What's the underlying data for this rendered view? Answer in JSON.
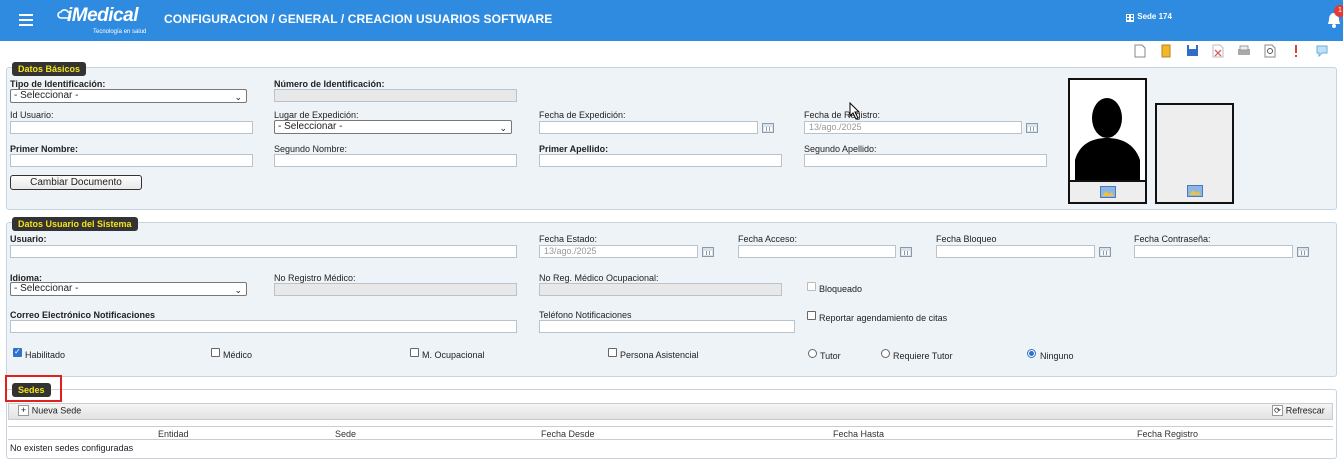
{
  "header": {
    "logo_name": "iMedical",
    "logo_tagline": "Tecnología en salud",
    "breadcrumb": "CONFIGURACION / GENERAL / CREACION USUARIOS SOFTWARE",
    "sede": "Sede 174",
    "notification_count": "1",
    "accent_color": "#2e8be0"
  },
  "toolbar": {
    "icons": [
      "new-document-icon",
      "attach-icon",
      "save-icon",
      "delete-icon",
      "print-icon",
      "search-document-icon",
      "alert-icon",
      "help-icon"
    ]
  },
  "datos_basicos": {
    "legend": "Datos Básicos",
    "tipo_id_label": "Tipo de Identificación:",
    "tipo_id_value": "- Seleccionar -",
    "numero_id_label": "Número de Identificación:",
    "id_usuario_label": "Id Usuario:",
    "lugar_exp_label": "Lugar de Expedición:",
    "lugar_exp_value": "- Seleccionar -",
    "fecha_exp_label": "Fecha de Expedición:",
    "fecha_reg_label": "Fecha de Registro:",
    "fecha_reg_value": "13/ago./2025",
    "primer_nombre_label": "Primer Nombre:",
    "segundo_nombre_label": "Segundo Nombre:",
    "primer_apellido_label": "Primer Apellido:",
    "segundo_apellido_label": "Segundo Apellido:",
    "cambiar_doc_button": "Cambiar Documento"
  },
  "datos_usuario": {
    "legend": "Datos Usuario del Sistema",
    "usuario_label": "Usuario:",
    "fecha_estado_label": "Fecha Estado:",
    "fecha_estado_value": "13/ago./2025",
    "fecha_acceso_label": "Fecha Acceso:",
    "fecha_bloqueo_label": "Fecha Bloqueo",
    "fecha_contrasena_label": "Fecha Contraseña:",
    "idioma_label": "Idioma:",
    "idioma_value": "- Seleccionar -",
    "no_registro_medico_label": "No Registro Médico:",
    "no_reg_medico_ocup_label": "No Reg. Médico Ocupacional:",
    "bloqueado_label": "Bloqueado",
    "correo_label": "Correo Electrónico Notificaciones",
    "telefono_label": "Teléfono Notificaciones",
    "reportar_label": "Reportar agendamiento de citas",
    "habilitado_label": "Habilitado",
    "medico_label": "Médico",
    "m_ocupacional_label": "M. Ocupacional",
    "persona_asistencial_label": "Persona Asistencial",
    "tutor_label": "Tutor",
    "requiere_tutor_label": "Requiere Tutor",
    "ninguno_label": "Ninguno"
  },
  "sedes": {
    "legend": "Sedes",
    "nueva_sede_button": "Nueva Sede",
    "refrescar_button": "Refrescar",
    "columns": [
      "Entidad",
      "Sede",
      "Fecha Desde",
      "Fecha Hasta",
      "Fecha Registro"
    ],
    "empty_message": "No existen sedes configuradas"
  }
}
